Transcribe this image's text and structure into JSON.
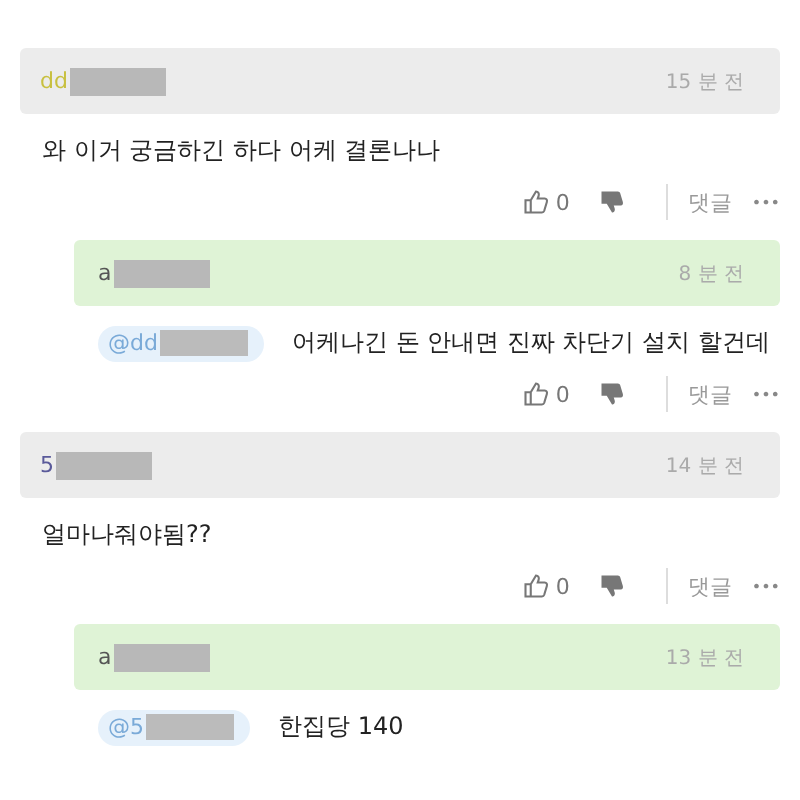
{
  "comments": [
    {
      "kind": "comment",
      "author": "dd",
      "color": "#c8c040",
      "time": "15 분 전",
      "text": "와 이거 궁금하긴 하다 어케 결론나나",
      "likes": "0",
      "reply_label": "댓글",
      "more": "•••"
    },
    {
      "kind": "reply",
      "author": "a",
      "color": "#555555",
      "time": "8 분 전",
      "mention": "@dd",
      "text": "어케나긴 돈 안내면 진짜 차단기 설치 할건데",
      "likes": "0",
      "reply_label": "댓글",
      "more": "•••"
    },
    {
      "kind": "comment",
      "author": "5",
      "color": "#5a5a9a",
      "time": "14 분 전",
      "text": "얼마나줘야됨??",
      "likes": "0",
      "reply_label": "댓글",
      "more": "•••"
    },
    {
      "kind": "reply",
      "author": "a",
      "color": "#555555",
      "time": "13 분 전",
      "mention": "@5",
      "text": "한집당 140"
    }
  ]
}
